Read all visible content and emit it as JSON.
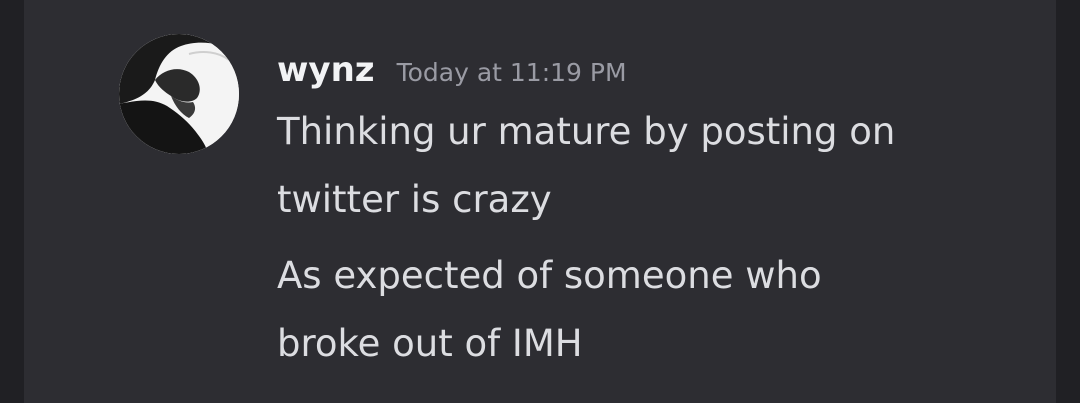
{
  "message": {
    "author": "wynz",
    "timestamp": "Today at 11:19 PM",
    "avatar_icon": "user-avatar-silhouette",
    "lines": [
      "Thinking ur mature by posting on",
      "twitter is crazy",
      "As expected of someone who",
      "broke out of IMH"
    ]
  },
  "colors": {
    "background": "#202024",
    "message_panel": "#2d2d32",
    "username": "#f2f3f5",
    "timestamp": "#9a9ba4",
    "text": "#dcdde1"
  }
}
